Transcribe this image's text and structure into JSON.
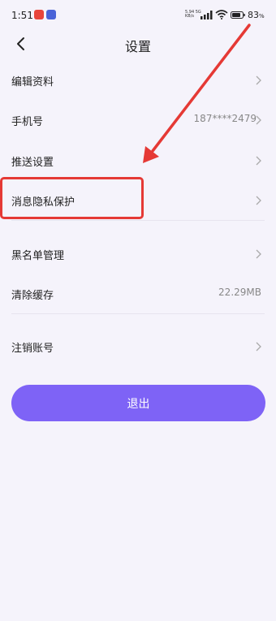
{
  "status_bar": {
    "time": "1:51",
    "network_speed": "5.94",
    "network_unit": "KB/s",
    "network_type": "5G",
    "battery_percent": "83",
    "battery_symbol": "%"
  },
  "header": {
    "title": "设置"
  },
  "settings": [
    {
      "label": "编辑资料",
      "value": ""
    },
    {
      "label": "手机号",
      "value": "187****2479"
    },
    {
      "label": "推送设置",
      "value": ""
    },
    {
      "label": "消息隐私保护",
      "value": ""
    },
    {
      "label": "黑名单管理",
      "value": ""
    },
    {
      "label": "清除缓存",
      "value": "22.29MB"
    },
    {
      "label": "注销账号",
      "value": ""
    }
  ],
  "logout": {
    "label": "退出"
  },
  "colors": {
    "background": "#f5f3fb",
    "accent": "#7e63f6",
    "annotation": "#e53935"
  },
  "icons": [
    "back-icon",
    "chevron-right-icon",
    "signal-icon",
    "wifi-icon",
    "battery-icon"
  ]
}
